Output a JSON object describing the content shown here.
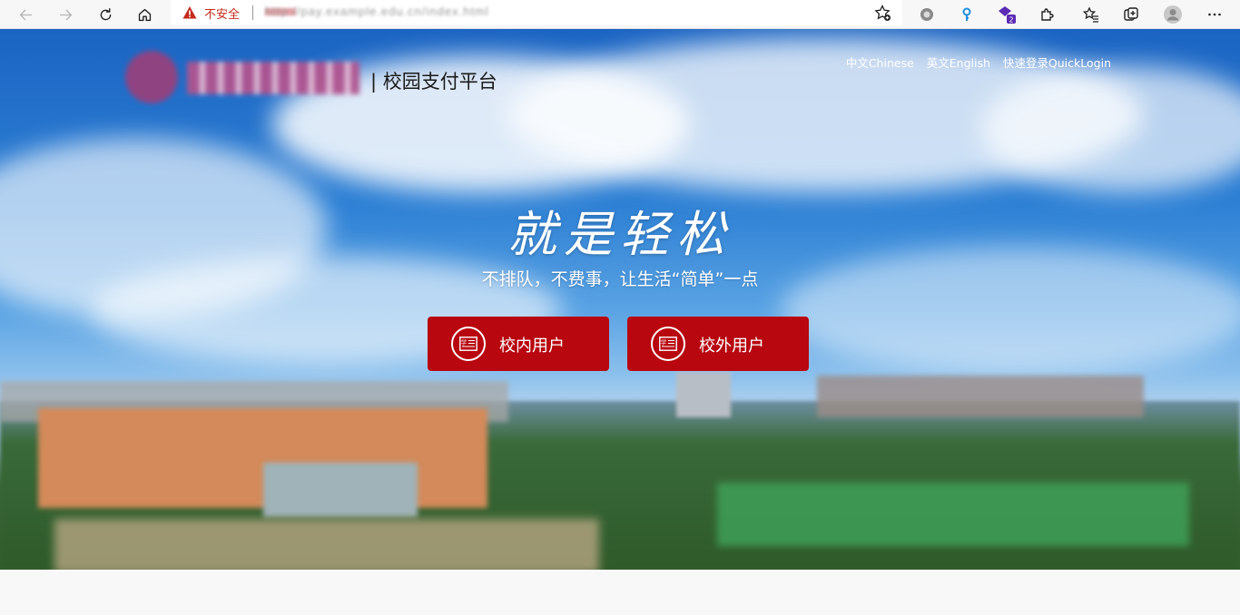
{
  "browser": {
    "security_label": "不安全",
    "url": "http://pay.example.edu.cn/index.html",
    "extension_badge": "2"
  },
  "header": {
    "site_title": "| 校园支付平台",
    "nav": {
      "chinese": "中文Chinese",
      "english": "英文English",
      "quick_login": "快速登录QuickLogin"
    }
  },
  "hero": {
    "slogan": "就是轻松",
    "subtitle": "不排队，不费事，让生活“简单”一点",
    "internal_user_label": "校内用户",
    "external_user_label": "校外用户"
  },
  "colors": {
    "accent": "#b8070f",
    "warning": "#c42b1c"
  },
  "icons": {
    "back": "arrow-left-icon",
    "forward": "arrow-right-icon",
    "refresh": "refresh-icon",
    "home": "home-icon",
    "warning": "warning-triangle-icon",
    "favorite": "star-plus-icon",
    "user_card": "id-card-icon"
  }
}
